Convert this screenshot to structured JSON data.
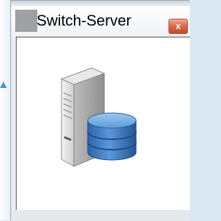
{
  "window": {
    "title": "Switch-Server",
    "close_glyph": "x"
  },
  "icons": {
    "app_icon": "app-icon",
    "close_icon": "close-icon",
    "main_illustration": "server-database-icon"
  },
  "colors": {
    "close_button": "#d96a4c",
    "database_blue": "#3f7fc9",
    "server_gray": "#dcdcdc"
  }
}
